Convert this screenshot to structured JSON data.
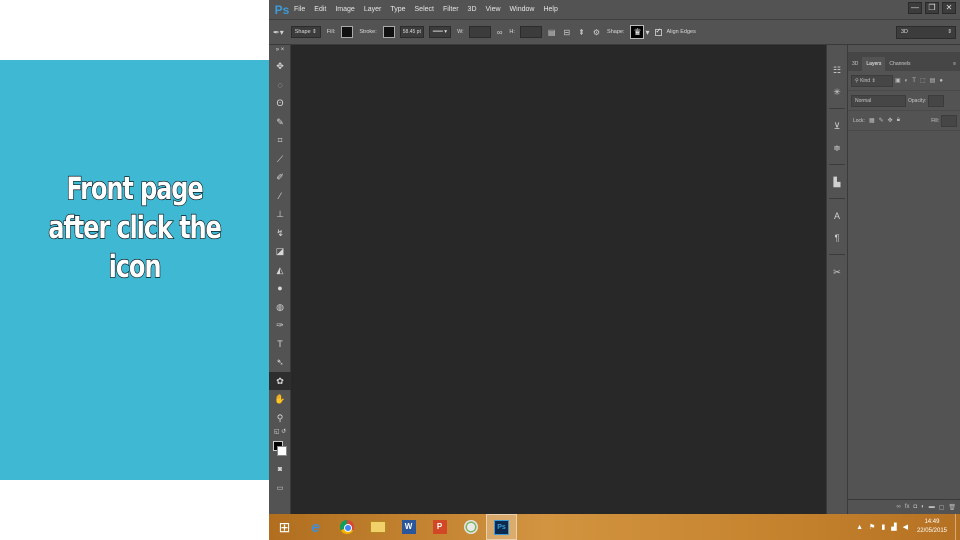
{
  "caption": {
    "lines": [
      "Front page",
      "after click the",
      "icon"
    ]
  },
  "photoshop": {
    "logo": "Ps",
    "menu": [
      "File",
      "Edit",
      "Image",
      "Layer",
      "Type",
      "Select",
      "Filter",
      "3D",
      "View",
      "Window",
      "Help"
    ],
    "window_controls": [
      "—",
      "❐",
      "✕"
    ],
    "options": {
      "tool_mode": "Shape",
      "fill_label": "Fill:",
      "stroke_label": "Stroke:",
      "stroke_width": "58.45 pt",
      "w_label": "W:",
      "h_label": "H:",
      "shape_label": "Shape:",
      "align_edges_label": "Align Edges",
      "workspace": "3D"
    },
    "tools_icons": [
      "move-icon",
      "marquee-icon",
      "lasso-icon",
      "quick-select-icon",
      "crop-icon",
      "eyedropper-icon",
      "healing-brush-icon",
      "brush-icon",
      "clone-stamp-icon",
      "history-brush-icon",
      "eraser-icon",
      "paint-bucket-icon",
      "blur-icon",
      "dodge-icon",
      "pen-icon",
      "type-icon",
      "path-select-icon",
      "custom-shape-icon",
      "hand-icon",
      "zoom-icon"
    ],
    "type_tool_glyph": "T",
    "layers_panel": {
      "tabs": [
        "3D",
        "Layers",
        "Channels"
      ],
      "active_tab": "Layers",
      "filter_kind": "Kind",
      "blend_mode": "Normal",
      "opacity_label": "Opacity:",
      "lock_label": "Lock:",
      "fill_label": "Fill:"
    }
  },
  "taskbar": {
    "clock_time": "14:49",
    "clock_date": "22/05/2015",
    "word_letter": "W",
    "ppt_letter": "P",
    "ps_letter": "Ps"
  },
  "colors": {
    "caption_bg": "#3fb8d4",
    "ps_ui": "#535353",
    "ps_canvas": "#282828",
    "taskbar": "#c98a35"
  }
}
